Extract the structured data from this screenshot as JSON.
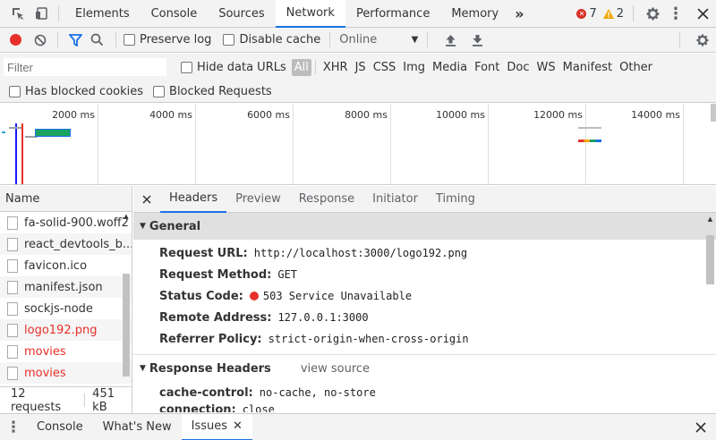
{
  "top_tabs": [
    "Elements",
    "Console",
    "Sources",
    "Network",
    "Performance",
    "Memory"
  ],
  "more_tabs_glyph": "»",
  "errors": {
    "count": "7",
    "color": "#d93025",
    "icon": "error-icon"
  },
  "warnings": {
    "count": "2",
    "color": "#f2a600",
    "icon": "warning-icon"
  },
  "toolbar": {
    "preserve_log": "Preserve log",
    "disable_cache": "Disable cache",
    "throttle": "Online"
  },
  "filter": {
    "placeholder": "Filter",
    "hide_data_urls": "Hide data URLs",
    "types": [
      "All",
      "XHR",
      "JS",
      "CSS",
      "Img",
      "Media",
      "Font",
      "Doc",
      "WS",
      "Manifest",
      "Other"
    ],
    "has_blocked_cookies": "Has blocked cookies",
    "blocked_requests": "Blocked Requests"
  },
  "overview": {
    "ticks": [
      "2000 ms",
      "4000 ms",
      "6000 ms",
      "8000 ms",
      "10000 ms",
      "12000 ms",
      "14000 ms"
    ]
  },
  "requests": {
    "header": "Name",
    "items": [
      {
        "name": "fa-solid-900.woff2",
        "error": false
      },
      {
        "name": "react_devtools_b...",
        "error": false
      },
      {
        "name": "favicon.ico",
        "error": false
      },
      {
        "name": "manifest.json",
        "error": false
      },
      {
        "name": "sockjs-node",
        "error": false
      },
      {
        "name": "logo192.png",
        "error": true
      },
      {
        "name": "movies",
        "error": true
      },
      {
        "name": "movies",
        "error": true
      }
    ],
    "summary_count": "12 requests",
    "summary_size": "451 kB"
  },
  "detail": {
    "tabs": [
      "Headers",
      "Preview",
      "Response",
      "Initiator",
      "Timing"
    ],
    "general_title": "General",
    "general": [
      {
        "key": "Request URL:",
        "value": "http://localhost:3000/logo192.png"
      },
      {
        "key": "Request Method:",
        "value": "GET"
      },
      {
        "key": "Status Code:",
        "value": "503 Service Unavailable"
      },
      {
        "key": "Remote Address:",
        "value": "127.0.0.1:3000"
      },
      {
        "key": "Referrer Policy:",
        "value": "strict-origin-when-cross-origin"
      }
    ],
    "response_title": "Response Headers",
    "view_source": "view source",
    "response": [
      {
        "key": "cache-control:",
        "value": "no-cache, no-store"
      },
      {
        "key": "connection:",
        "value": "close"
      }
    ]
  },
  "drawer": {
    "tabs": [
      "Console",
      "What's New",
      "Issues"
    ]
  },
  "colors": {
    "accent": "#1a73e8",
    "record": "#e8302a",
    "error_text": "#e8302a"
  }
}
